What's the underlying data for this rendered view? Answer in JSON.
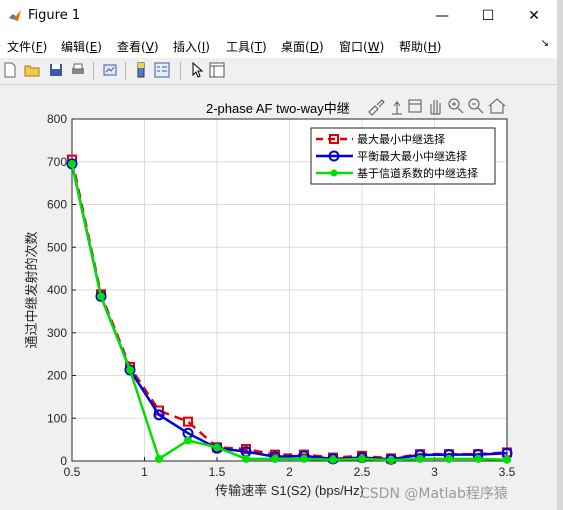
{
  "window": {
    "title": "Figure 1",
    "minimize_glyph": "—",
    "maximize_glyph": "☐",
    "close_glyph": "✕"
  },
  "menubar": {
    "items": [
      {
        "label": "文件(",
        "key": "F",
        "end": ")"
      },
      {
        "label": "编辑(",
        "key": "E",
        "end": ")"
      },
      {
        "label": "查看(",
        "key": "V",
        "end": ")"
      },
      {
        "label": "插入(",
        "key": "I",
        "end": ")"
      },
      {
        "label": "工具(",
        "key": "T",
        "end": ")"
      },
      {
        "label": "桌面(",
        "key": "D",
        "end": ")"
      },
      {
        "label": "窗口(",
        "key": "W",
        "end": ")"
      },
      {
        "label": "帮助(",
        "key": "H",
        "end": ")"
      }
    ],
    "dock_glyph": "↘"
  },
  "toolbar": {
    "icons": [
      "new-figure-icon",
      "open-file-icon",
      "save-icon",
      "print-icon",
      "link-plot-icon",
      "insert-colorbar-icon",
      "insert-legend-icon",
      "pointer-icon",
      "property-inspector-icon"
    ]
  },
  "axes_toolbar": {
    "icons": [
      "brush-icon",
      "data-tips-icon",
      "rotate-icon",
      "pan-icon",
      "zoom-in-icon",
      "zoom-out-icon",
      "home-icon"
    ]
  },
  "chart_data": {
    "type": "line",
    "title": "2-phase AF two-way中继",
    "xlabel": "传输速率 S1(S2) (bps/Hz)",
    "ylabel": "通过中继发射的次数",
    "xlim": [
      0.5,
      3.5
    ],
    "ylim": [
      0,
      800
    ],
    "xticks": [
      "0.5",
      "1",
      "1.5",
      "2",
      "2.5",
      "3",
      "3.5"
    ],
    "yticks": [
      "0",
      "100",
      "200",
      "300",
      "400",
      "500",
      "600",
      "700",
      "800"
    ],
    "grid": true,
    "legend_position": "top-right",
    "x": [
      0.5,
      0.7,
      0.9,
      1.1,
      1.3,
      1.5,
      1.7,
      1.9,
      2.1,
      2.3,
      2.5,
      2.7,
      2.9,
      3.1,
      3.3,
      3.5
    ],
    "series": [
      {
        "name": "最大最小中继选择",
        "color": "#e00000",
        "style": "dashed",
        "marker": "square",
        "values": [
          705,
          390,
          220,
          118,
          92,
          32,
          28,
          15,
          15,
          8,
          12,
          6,
          16,
          16,
          16,
          20
        ]
      },
      {
        "name": "平衡最大最小中继选择",
        "color": "#0000e0",
        "style": "solid",
        "marker": "circle",
        "values": [
          695,
          385,
          213,
          108,
          65,
          30,
          22,
          10,
          12,
          5,
          8,
          4,
          14,
          15,
          15,
          18
        ]
      },
      {
        "name": "基于信道系数的中继选择",
        "color": "#00e000",
        "style": "solid",
        "marker": "dot",
        "values": [
          695,
          385,
          213,
          5,
          48,
          32,
          5,
          5,
          5,
          3,
          5,
          2,
          5,
          5,
          5,
          3
        ]
      }
    ]
  },
  "watermark": "CSDN @Matlab程序猿"
}
